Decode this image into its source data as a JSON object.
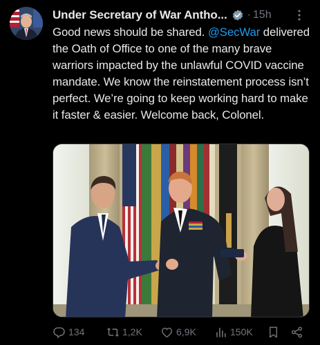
{
  "author": {
    "display_name": "Under Secretary of War Antho...",
    "verified_badge": "gray-check-icon",
    "separator": "·",
    "time": "15h"
  },
  "tweet": {
    "text_before_mention": "Good news should be shared. ",
    "mention": "@SecWar",
    "text_after_mention": " delivered the Oath of Office to one of the many brave warriors impacted by the unlawful COVID vaccine mandate. We know the reinstatement process isn’t perfect. We’re going to keep working hard to make it faster & easier. Welcome back, Colonel."
  },
  "actions": {
    "replies": "134",
    "reposts": "1,2K",
    "likes": "6,9K",
    "views": "150K"
  },
  "colors": {
    "background": "#000000",
    "text": "#e7e9ea",
    "muted": "#71767b",
    "link": "#1d9bf0"
  }
}
